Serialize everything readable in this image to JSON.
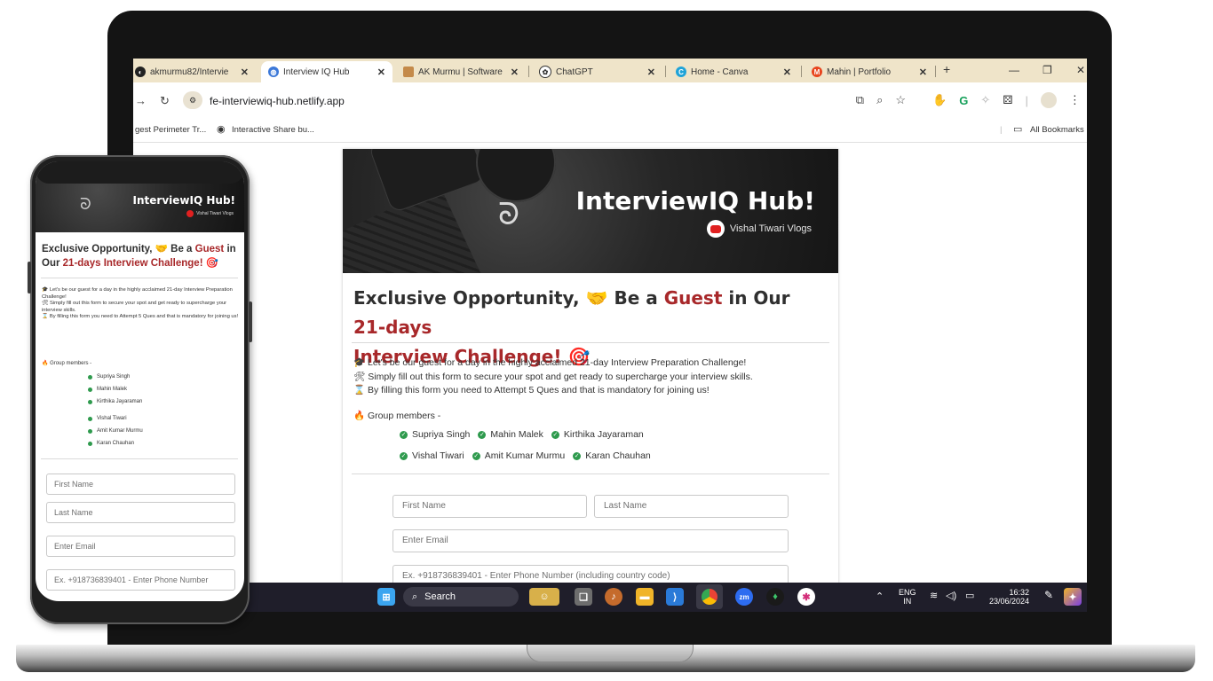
{
  "browser": {
    "tabs": [
      {
        "label": "akmurmu82/Intervie",
        "icon": "github-icon"
      },
      {
        "label": "Interview IQ Hub",
        "icon": "globe-icon"
      },
      {
        "label": "AK Murmu | Software",
        "icon": "avatar-icon"
      },
      {
        "label": "ChatGPT",
        "icon": "chatgpt-icon"
      },
      {
        "label": "Home - Canva",
        "icon": "canva-icon"
      },
      {
        "label": "Mahin | Portfolio",
        "icon": "m-logo-icon"
      }
    ],
    "close_glyph": "✕",
    "new_tab": "+",
    "url": "fe-interviewiq-hub.netlify.app",
    "bookmarks": [
      {
        "label": "gest Perimeter Tr..."
      },
      {
        "label": "Interactive Share bu..."
      }
    ],
    "all_bookmarks": "All Bookmarks"
  },
  "page": {
    "banner_title": "InterviewIQ Hub!",
    "banner_sub": "Vishal Tiwari Vlogs",
    "headline": {
      "part1": "Exclusive Opportunity,",
      "emoji1": "🤝",
      "part2": "Be a",
      "guest": "Guest",
      "part3": "in Our",
      "days": "21-days",
      "challenge": "Interview Challenge!",
      "emoji2": "🎯"
    },
    "intro_lines": [
      "🎓 Let's be our guest for a day in the highly acclaimed 21-day Interview Preparation Challenge!",
      "🛠 Simply fill out this form to secure your spot and get ready to supercharge your interview skills.",
      "⌛ By filling this form you need to Attempt 5 Ques and that is mandatory for joining us!"
    ],
    "members_title": "🔥 Group members -",
    "members_row1": [
      "Supriya Singh",
      "Mahin Malek",
      "Kirthika Jayaraman"
    ],
    "members_row2": [
      "Vishal Tiwari",
      "Amit Kumar Murmu",
      "Karan Chauhan"
    ],
    "form": {
      "first_name": "First Name",
      "last_name": "Last Name",
      "email": "Enter Email",
      "phone": "Ex. +918736839401 - Enter Phone Number (including country code)"
    }
  },
  "phone": {
    "phone_placeholder": "Ex. +918736839401 - Enter Phone Number"
  },
  "taskbar": {
    "search": "Search",
    "lang": "ENG",
    "region": "IN",
    "time": "16:32",
    "date": "23/06/2024"
  },
  "colors": {
    "accent_red": "#a8282a",
    "check_green": "#2e9a4d",
    "tabbar_bg": "#efe4c9",
    "taskbar_bg": "#1f1e2a"
  }
}
